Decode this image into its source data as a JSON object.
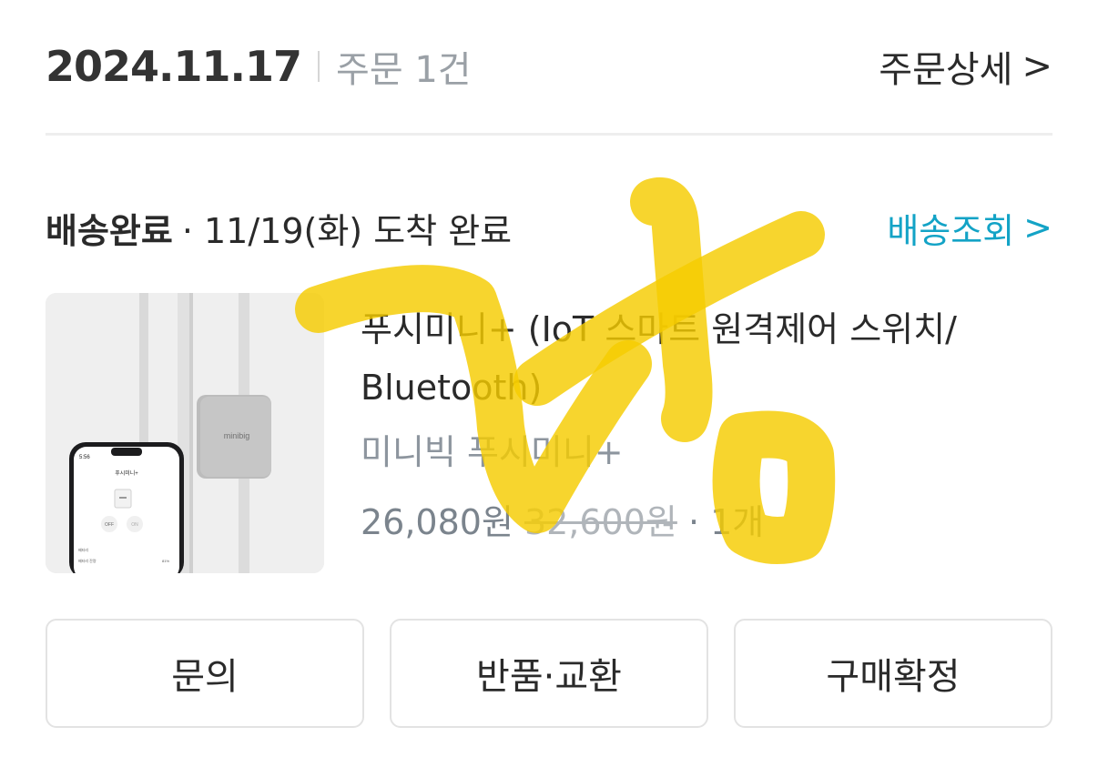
{
  "header": {
    "date": "2024.11.17",
    "order_count": "주문 1건",
    "detail_label": "주문상세",
    "detail_chevron": ">"
  },
  "delivery": {
    "status": "배송완료",
    "info": "· 11/19(화) 도착 완료",
    "track_label": "배송조회",
    "track_chevron": ">",
    "accent_color": "#13a3c6"
  },
  "product": {
    "name": "푸시미니+ (IoT 스마트 원격제어 스위치/ Bluetooth)",
    "brand": "미니빅 푸시미니+",
    "price": "26,080원",
    "original_price": "32,600원",
    "quantity": "· 1개",
    "thumb": {
      "device_label": "minibig",
      "phone_time": "5:56",
      "phone_title": "푸시미니+",
      "off_label": "OFF",
      "on_label": "ON",
      "section_label": "배터리",
      "battery_label": "배터리 잔량",
      "battery_value": "81%"
    }
  },
  "actions": {
    "inquiry": "문의",
    "return_exchange": "반품·교환",
    "confirm_purchase": "구매확정"
  },
  "overlay": {
    "scribble_color": "#f5cc00"
  }
}
